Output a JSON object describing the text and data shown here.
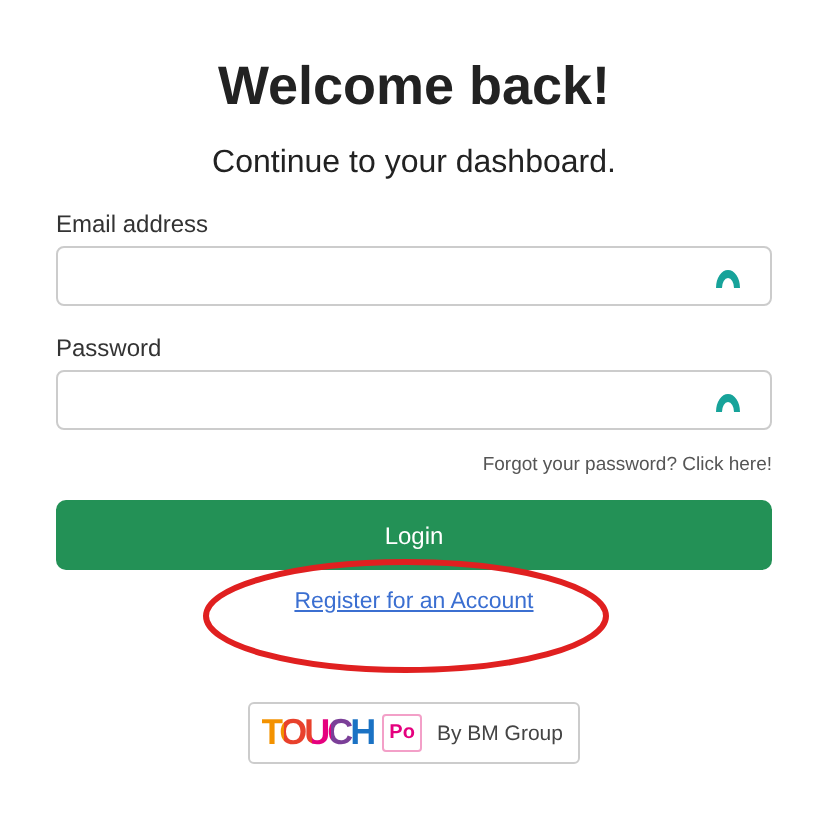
{
  "title": "Welcome back!",
  "subtitle": "Continue to your dashboard.",
  "fields": [
    {
      "label": "Email address"
    },
    {
      "label": "Password"
    }
  ],
  "forgot_link": "Forgot your password? Click here!",
  "login_button": "Login",
  "register_link": "Register for an Account",
  "annotation": {
    "kind": "ellipse",
    "color": "#e02020"
  },
  "badge": {
    "logo": "TOUCH",
    "mark": "Po",
    "text": "By BM Group"
  }
}
